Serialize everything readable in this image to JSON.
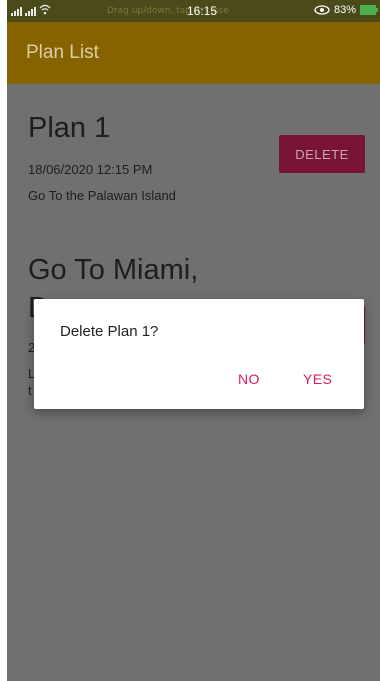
{
  "status_bar": {
    "time": "16:15",
    "notice": "Drag up/down, tap to close",
    "battery": "83%"
  },
  "app_bar": {
    "title": "Plan List"
  },
  "plans": [
    {
      "title": "Plan 1",
      "date": "18/06/2020 12:15 PM",
      "description": "Go To the Palawan Island",
      "delete_label": "DELETE"
    },
    {
      "title_line1": "Go To Miami,",
      "title_line2": "D",
      "date_partial": "2",
      "desc_line1_partial": "L",
      "desc_line2_partial": "t",
      "delete_label": ""
    }
  ],
  "dialog": {
    "message": "Delete Plan 1?",
    "no_label": "NO",
    "yes_label": "YES"
  },
  "colors": {
    "app_bar": "#876300",
    "accent": "#d81b60",
    "delete_button": "#7a1435"
  }
}
